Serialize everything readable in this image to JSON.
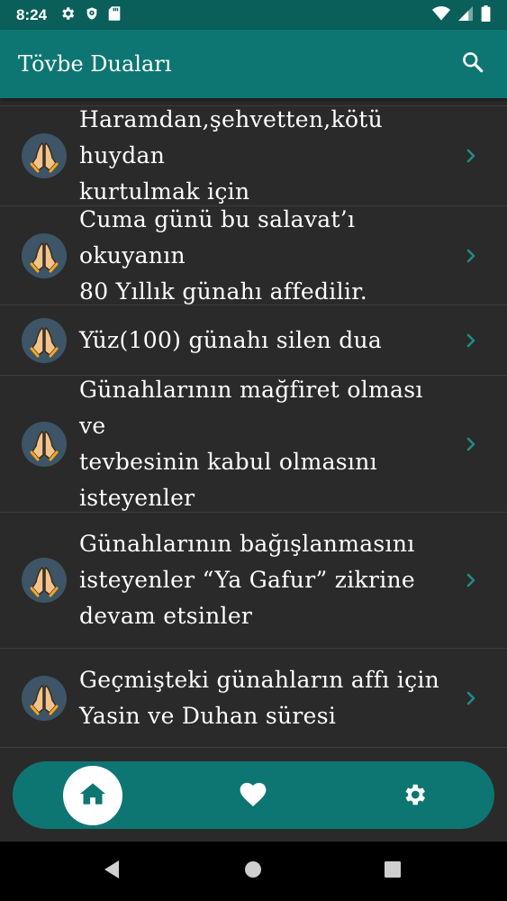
{
  "status_bar": {
    "time": "8:24",
    "left_icons": [
      "gear-icon",
      "shield-icon",
      "sd-card-icon"
    ],
    "right_icons": [
      "wifi-icon",
      "cell-signal-icon",
      "battery-icon"
    ]
  },
  "app_bar": {
    "title": "Tövbe Duaları",
    "search_icon": "search-icon"
  },
  "list": {
    "items": [
      {
        "lines": [
          "Haramdan,şehvetten,kötü huydan",
          "kurtulmak için"
        ],
        "icon": "praying-hands-icon"
      },
      {
        "lines": [
          "Cuma günü bu salavat’ı okuyanın",
          "80 Yıllık günahı affedilir."
        ],
        "icon": "praying-hands-icon"
      },
      {
        "lines": [
          "Yüz(100) günahı silen dua"
        ],
        "icon": "praying-hands-icon"
      },
      {
        "lines": [
          "Günahlarının mağfiret olması ve",
          "tevbesinin kabul olmasını",
          "isteyenler"
        ],
        "icon": "praying-hands-icon"
      },
      {
        "lines": [
          "Günahlarının bağışlanmasını",
          "isteyenler “Ya Gafur” zikrine",
          "devam etsinler"
        ],
        "icon": "praying-hands-icon"
      },
      {
        "lines": [
          "Geçmişteki günahların affı için",
          "Yasin ve Duhan süresi"
        ],
        "icon": "praying-hands-icon"
      }
    ]
  },
  "bottom_nav": {
    "items": [
      "home-icon",
      "heart-icon",
      "settings-icon"
    ],
    "selected": "home-icon"
  },
  "colors": {
    "primary": "#0e7672",
    "status_bar": "#0b5f5a",
    "background": "#2a2a2a",
    "chevron": "#1e8c86"
  }
}
